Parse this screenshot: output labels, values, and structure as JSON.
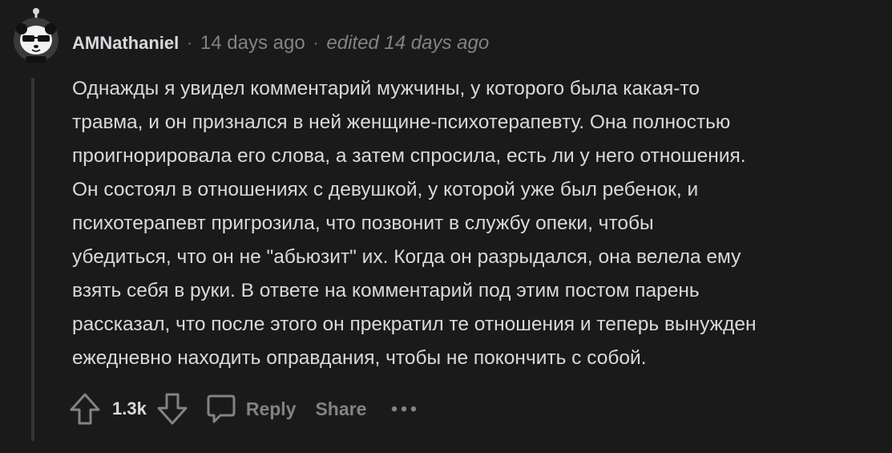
{
  "comment": {
    "author": "AMNathaniel",
    "separator": "·",
    "timestamp": "14 days ago",
    "edited": "edited 14 days ago",
    "body_lines": [
      "Однажды я увидел комментарий мужчины, у которого была какая-то",
      "травма, и он признался в ней женщине-психотерапевту. Она полностью",
      "проигнорировала его слова, а затем спросила, есть ли у него отношения.",
      "Он состоял в отношениях с девушкой, у которой уже был ребенок, и",
      "психотерапевт пригрозила, что позвонит в службу опеки, чтобы",
      "убедиться, что он не \"абьюзит\" их. Когда он разрыдался, она велела ему",
      "взять себя в руки. В ответе на комментарий под этим постом парень",
      "рассказал, что после этого он прекратил те отношения и теперь вынужден",
      "ежедневно находить оправдания, чтобы не покончить с собой."
    ]
  },
  "actions": {
    "upvote_icon": "upvote-arrow-icon",
    "score": "1.3k",
    "downvote_icon": "downvote-arrow-icon",
    "reply_icon": "speech-bubble-icon",
    "reply_label": "Reply",
    "share_label": "Share",
    "more_icon": "ellipsis-icon"
  },
  "colors": {
    "background": "#1a1a1b",
    "text": "#d7dadc",
    "muted": "#818384",
    "thread_line": "#343536"
  }
}
